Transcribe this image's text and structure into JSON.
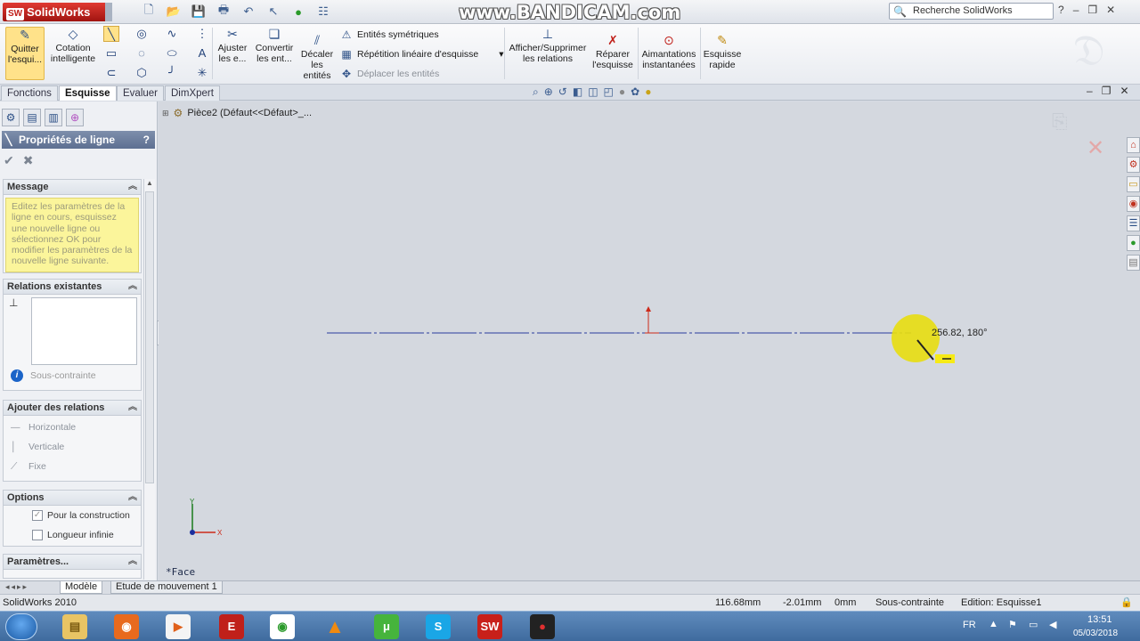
{
  "titlebar": {
    "app_name": "SolidWorks",
    "logo_badge": "SW",
    "watermark": "www.BANDICAM.com",
    "search_placeholder": "Recherche SolidWorks",
    "help_label": "?"
  },
  "ribbon": {
    "quit_sketch": "Quitter l'esqui...",
    "smart_dim": "Cotation intelligente",
    "trim": "Ajuster les e...",
    "convert": "Convertir les ent...",
    "offset": "Décaler les entités",
    "mirror": "Entités symétriques",
    "linear_pattern": "Répétition linéaire d'esquisse",
    "move": "Déplacer les entités",
    "display_relations": "Afficher/Supprimer les relations",
    "repair": "Réparer l'esquisse",
    "snaps": "Aimantations instantanées",
    "rapid_sketch": "Esquisse rapide"
  },
  "tabs": {
    "features": "Fonctions",
    "sketch": "Esquisse",
    "evaluate": "Evaluer",
    "dimxpert": "DimXpert"
  },
  "panel": {
    "title": "Propriétés de ligne",
    "help": "?",
    "message_header": "Message",
    "message_text": "Editez les paramètres de la ligne en cours, esquissez une nouvelle ligne ou sélectionnez OK pour modifier les paramètres de la nouvelle ligne suivante.",
    "existing_header": "Relations existantes",
    "under_defined": "Sous-contrainte",
    "add_rel_header": "Ajouter des relations",
    "add_relations": [
      "Horizontale",
      "Verticale",
      "Fixe"
    ],
    "options_header": "Options",
    "opt_construction": "Pour la construction",
    "opt_infinite": "Longueur infinie",
    "params_header": "Paramètres..."
  },
  "canvas": {
    "tree_path": "Pièce2  (Défaut<<Défaut>_...",
    "face_label": "*Face",
    "dimension": "256.82, 180°"
  },
  "model_tabs": {
    "model": "Modèle",
    "motion": "Etude de mouvement 1"
  },
  "status": {
    "app_version": "SolidWorks 2010",
    "x": "116.68mm",
    "y": "-2.01mm",
    "z": "0mm",
    "state": "Sous-contrainte",
    "editing": "Edition: Esquisse1"
  },
  "taskbar": {
    "lang": "FR",
    "time": "13:51",
    "date": "05/03/2018"
  },
  "colors": {
    "sketch_line": "#2a3d9c",
    "origin": "#cc2a1a",
    "highlight": "#f6ea16",
    "message_bg": "#fbf59b"
  }
}
